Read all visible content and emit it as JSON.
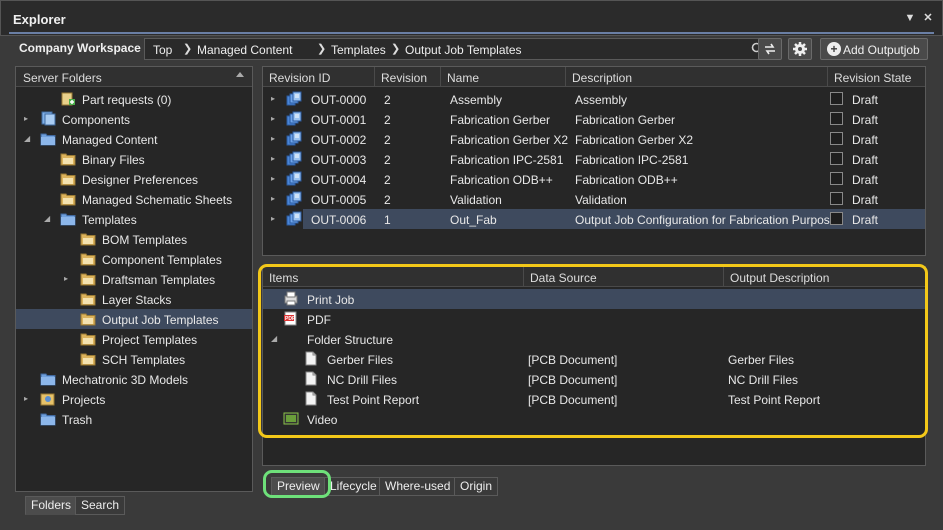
{
  "window": {
    "title": "Explorer"
  },
  "toolbar": {
    "workspace": "Company Workspace",
    "breadcrumb": [
      "Top",
      "Managed Content",
      "Templates",
      "Output Job Templates"
    ],
    "add_button": "Add Outputjob"
  },
  "left": {
    "header": "Server Folders",
    "items": [
      {
        "label": "Part requests (0)",
        "icon": "part-requests-icon",
        "indent": 1,
        "expander": ""
      },
      {
        "label": "Components",
        "icon": "components-icon",
        "indent": 0,
        "expander": "▸"
      },
      {
        "label": "Managed Content",
        "icon": "blue-folder-icon",
        "indent": 0,
        "expander": "◢"
      },
      {
        "label": "Binary Files",
        "icon": "folder-icon",
        "indent": 1,
        "expander": ""
      },
      {
        "label": "Designer Preferences",
        "icon": "folder-icon",
        "indent": 1,
        "expander": ""
      },
      {
        "label": "Managed Schematic Sheets",
        "icon": "folder-icon",
        "indent": 1,
        "expander": ""
      },
      {
        "label": "Templates",
        "icon": "blue-folder-icon",
        "indent": 1,
        "expander": "◢"
      },
      {
        "label": "BOM Templates",
        "icon": "folder-icon",
        "indent": 2,
        "expander": ""
      },
      {
        "label": "Component Templates",
        "icon": "folder-icon",
        "indent": 2,
        "expander": ""
      },
      {
        "label": "Draftsman Templates",
        "icon": "folder-icon",
        "indent": 2,
        "expander": "▸"
      },
      {
        "label": "Layer Stacks",
        "icon": "folder-icon",
        "indent": 2,
        "expander": ""
      },
      {
        "label": "Output Job Templates",
        "icon": "folder-icon",
        "indent": 2,
        "expander": ""
      },
      {
        "label": "Project Templates",
        "icon": "folder-icon",
        "indent": 2,
        "expander": ""
      },
      {
        "label": "SCH Templates",
        "icon": "folder-icon",
        "indent": 2,
        "expander": ""
      },
      {
        "label": "Mechatronic 3D Models",
        "icon": "blue-folder-icon",
        "indent": 0,
        "expander": ""
      },
      {
        "label": "Projects",
        "icon": "projects-icon",
        "indent": 0,
        "expander": "▸"
      },
      {
        "label": "Trash",
        "icon": "blue-folder-icon",
        "indent": 0,
        "expander": ""
      }
    ],
    "tabs": [
      "Folders",
      "Search"
    ]
  },
  "table": {
    "columns": [
      "Revision ID",
      "Revision",
      "Name",
      "Description",
      "Revision State"
    ],
    "rows": [
      {
        "id": "OUT-0000",
        "rev": "2",
        "name": "Assembly",
        "desc": "Assembly",
        "state": "Draft"
      },
      {
        "id": "OUT-0001",
        "rev": "2",
        "name": "Fabrication Gerber",
        "desc": "Fabrication Gerber",
        "state": "Draft"
      },
      {
        "id": "OUT-0002",
        "rev": "2",
        "name": "Fabrication Gerber X2",
        "desc": "Fabrication Gerber X2",
        "state": "Draft"
      },
      {
        "id": "OUT-0003",
        "rev": "2",
        "name": "Fabrication IPC-2581",
        "desc": "Fabrication IPC-2581",
        "state": "Draft"
      },
      {
        "id": "OUT-0004",
        "rev": "2",
        "name": "Fabrication ODB++",
        "desc": "Fabrication ODB++",
        "state": "Draft"
      },
      {
        "id": "OUT-0005",
        "rev": "2",
        "name": "Validation",
        "desc": "Validation",
        "state": "Draft"
      },
      {
        "id": "OUT-0006",
        "rev": "1",
        "name": "Out_Fab",
        "desc": "Output Job Configuration for Fabrication Purposes",
        "state": "Draft"
      }
    ]
  },
  "preview": {
    "columns": [
      "Items",
      "Data Source",
      "Output Description"
    ],
    "rows": [
      {
        "label": "Print Job",
        "source": "",
        "output": ""
      },
      {
        "label": "PDF",
        "source": "",
        "output": ""
      },
      {
        "label": "Folder Structure",
        "source": "",
        "output": ""
      },
      {
        "label": "Gerber Files",
        "source": "[PCB Document]",
        "output": "Gerber Files"
      },
      {
        "label": "NC Drill Files",
        "source": "[PCB Document]",
        "output": "NC Drill Files"
      },
      {
        "label": "Test Point Report",
        "source": "[PCB Document]",
        "output": "Test Point Report"
      },
      {
        "label": "Video",
        "source": "",
        "output": ""
      }
    ],
    "tabs": [
      "Preview",
      "Lifecycle",
      "Where-used",
      "Origin"
    ]
  },
  "colors": {
    "selection": "#3e4a5e",
    "highlight_yellow": "#f3c819",
    "highlight_green": "#6ee07a"
  }
}
